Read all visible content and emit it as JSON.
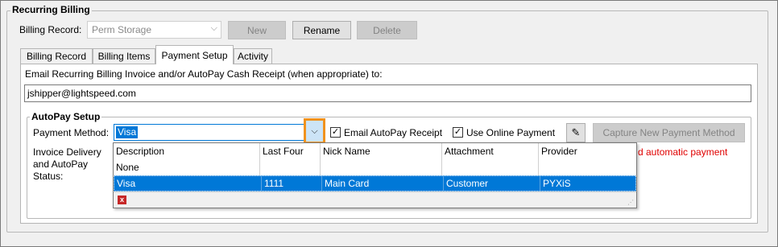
{
  "group": {
    "title": "Recurring Billing"
  },
  "billing_record": {
    "label": "Billing Record:",
    "value": "Perm Storage",
    "new_label": "New",
    "rename_label": "Rename",
    "delete_label": "Delete"
  },
  "tabs": [
    {
      "label": "Billing Record"
    },
    {
      "label": "Billing Items"
    },
    {
      "label": "Payment Setup"
    },
    {
      "label": "Activity"
    }
  ],
  "payment_setup": {
    "email_label": "Email Recurring Billing Invoice and/or AutoPay Cash Receipt (when appropriate) to:",
    "email_value": "jshipper@lightspeed.com"
  },
  "autopay": {
    "title": "AutoPay Setup",
    "payment_method_label": "Payment Method:",
    "payment_method_value": "Visa",
    "email_receipt_label": "Email AutoPay Receipt",
    "email_receipt_checked": true,
    "online_payment_label": "Use Online Payment",
    "online_payment_checked": true,
    "capture_label": "Capture New Payment Method",
    "delivery_label_1": "Invoice Delivery",
    "delivery_label_2": "and AutoPay",
    "delivery_label_3": "Status:",
    "status_text": "d automatic payment"
  },
  "dropdown": {
    "headers": [
      "Description",
      "Last Four",
      "Nick Name",
      "Attachment",
      "Provider"
    ],
    "rows": [
      {
        "description": "None",
        "last_four": "",
        "nick_name": "",
        "attachment": "",
        "provider": ""
      },
      {
        "description": "Visa",
        "last_four": "1111",
        "nick_name": "Main Card",
        "attachment": "Customer",
        "provider": "PYXiS"
      }
    ],
    "selected_index": 1
  },
  "colors": {
    "highlight_box": "#f0921e",
    "selection": "#0078d7",
    "status_text": "#e00000"
  }
}
